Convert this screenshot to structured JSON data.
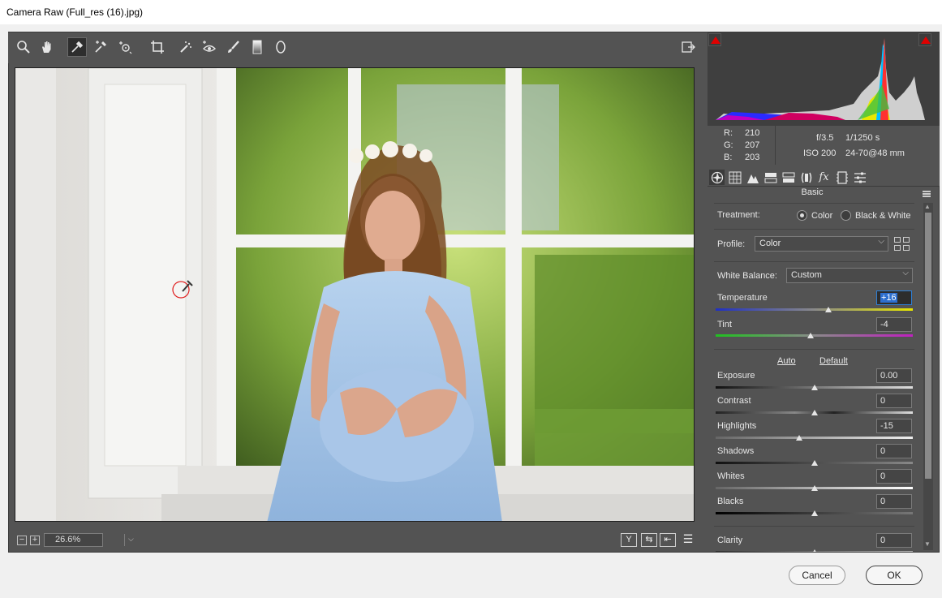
{
  "window": {
    "title": "Camera Raw (Full_res (16).jpg)"
  },
  "toolbar": {
    "tools": [
      "zoom-icon",
      "hand-icon",
      "white-balance-eyedropper-icon",
      "color-sampler-icon",
      "targeted-adjustment-icon",
      "crop-icon",
      "spot-removal-icon",
      "red-eye-icon",
      "adjustment-brush-icon",
      "graduated-filter-icon",
      "radial-filter-icon"
    ],
    "active_tool": "white-balance-eyedropper-icon",
    "fullscreen_icon": "open-fullscreen-icon"
  },
  "statusbar": {
    "zoom_out": "−",
    "zoom_in": "+",
    "zoom_value": "26.6%",
    "view_buttons": [
      "Y",
      "⇆",
      "⇤",
      "☰"
    ]
  },
  "readout": {
    "r_label": "R:",
    "g_label": "G:",
    "b_label": "B:",
    "r": "210",
    "g": "207",
    "b": "203",
    "aperture": "f/3.5",
    "shutter": "1/1250 s",
    "iso": "ISO 200",
    "lens": "24-70@48 mm"
  },
  "panel": {
    "title": "Basic",
    "treatment_label": "Treatment:",
    "color_label": "Color",
    "bw_label": "Black & White",
    "profile_label": "Profile:",
    "profile_value": "Color",
    "wb_label": "White Balance:",
    "wb_value": "Custom",
    "auto_link": "Auto",
    "default_link": "Default",
    "sliders": [
      {
        "label": "Temperature",
        "value": "+16",
        "pos": 0.57
      },
      {
        "label": "Tint",
        "value": "-4",
        "pos": 0.48
      },
      {
        "label": "Exposure",
        "value": "0.00",
        "pos": 0.5
      },
      {
        "label": "Contrast",
        "value": "0",
        "pos": 0.5
      },
      {
        "label": "Highlights",
        "value": "-15",
        "pos": 0.425
      },
      {
        "label": "Shadows",
        "value": "0",
        "pos": 0.5
      },
      {
        "label": "Whites",
        "value": "0",
        "pos": 0.5
      },
      {
        "label": "Blacks",
        "value": "0",
        "pos": 0.5
      },
      {
        "label": "Clarity",
        "value": "0",
        "pos": 0.5
      }
    ]
  },
  "buttons": {
    "cancel": "Cancel",
    "ok": "OK"
  },
  "colors": {
    "bg": "#535353",
    "panel_dark": "#3f3f3f",
    "accent": "#2d7fd6",
    "clip_warning": "#e10000"
  }
}
